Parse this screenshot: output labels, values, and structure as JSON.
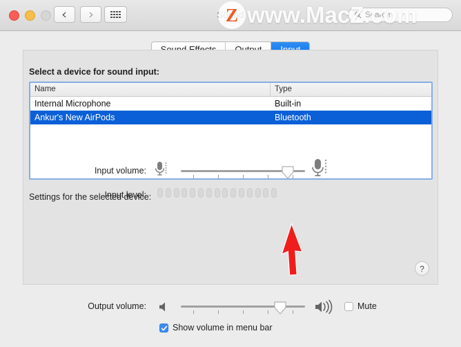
{
  "window": {
    "title": "Sound",
    "traffic_lights": [
      "close",
      "minimize",
      "zoom"
    ],
    "nav": {
      "back": "back-arrow",
      "forward": "forward-arrow",
      "show_all": "grid-icon"
    },
    "search": {
      "placeholder": "Search",
      "value": "",
      "icon": "search-icon"
    }
  },
  "watermark": {
    "logo_letter": "Z",
    "text": "www.MacZ.com",
    "logo_color": "#ee5a24"
  },
  "tabs": [
    {
      "label": "Sound Effects",
      "active": false
    },
    {
      "label": "Output",
      "active": false
    },
    {
      "label": "Input",
      "active": true
    }
  ],
  "device_section": {
    "heading": "Select a device for sound input:",
    "columns": [
      "Name",
      "Type"
    ],
    "rows": [
      {
        "name": "Internal Microphone",
        "type": "Built-in",
        "selected": false
      },
      {
        "name": "Ankur's New AirPods",
        "type": "Bluetooth",
        "selected": true
      }
    ],
    "selection_color": "#0b60d8"
  },
  "settings": {
    "heading": "Settings for the selected device:",
    "input_volume": {
      "label": "Input volume:",
      "value_percent": 86,
      "tick_count": 5,
      "left_icon": "microphone-small-icon",
      "right_icon": "microphone-large-icon"
    },
    "input_level": {
      "label": "Input level:",
      "segment_count": 15,
      "active_segments": 0
    },
    "help_button": "?"
  },
  "output": {
    "label": "Output volume:",
    "value_percent": 80,
    "tick_count": 5,
    "left_icon": "speaker-mute-icon",
    "right_icon": "speaker-loud-icon",
    "mute": {
      "label": "Mute",
      "checked": false
    },
    "show_volume": {
      "label": "Show volume in menu bar",
      "checked": true
    }
  },
  "annotation": {
    "type": "red-arrow-cursor",
    "color": "#f01d1d",
    "points_at": "input-volume-slider-thumb"
  }
}
